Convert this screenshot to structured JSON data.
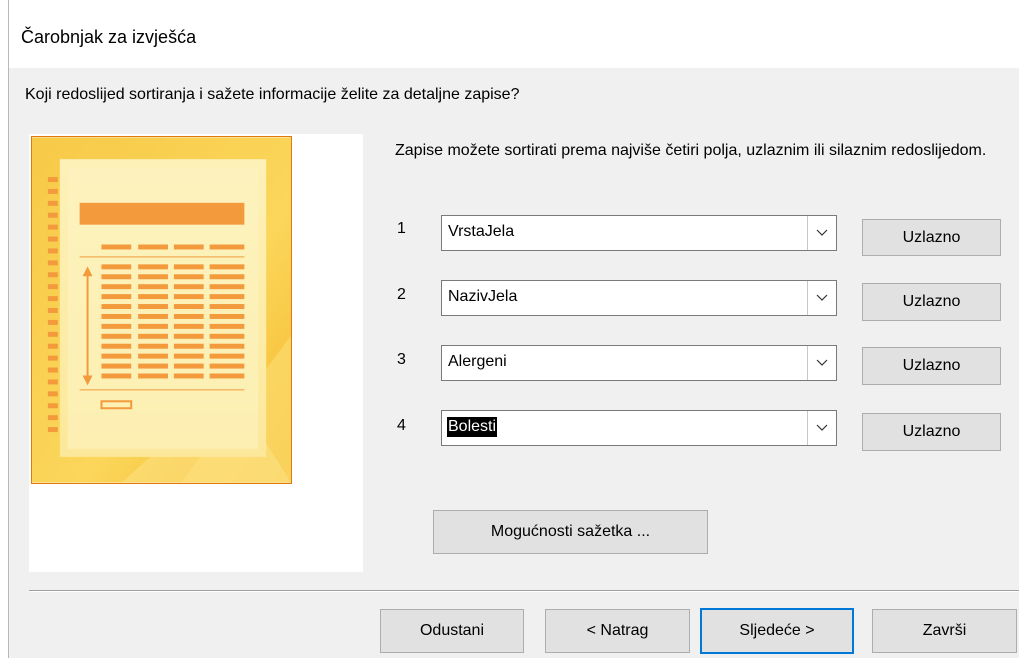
{
  "dialog": {
    "title": "Čarobnjak za izvješća",
    "question": "Koji redoslijed sortiranja i sažete informacije želite za detaljne zapise?",
    "intro": "Zapise možete sortirati prema najviše četiri polja, uzlaznim ili silaznim redoslijedom."
  },
  "sort_rows": [
    {
      "number": "1",
      "field": "VrstaJela",
      "order": "Uzlazno"
    },
    {
      "number": "2",
      "field": "NazivJela",
      "order": "Uzlazno"
    },
    {
      "number": "3",
      "field": "Alergeni",
      "order": "Uzlazno"
    },
    {
      "number": "4",
      "field": "Bolesti",
      "order": "Uzlazno"
    }
  ],
  "summary_button": "Mogućnosti sažetka ...",
  "footer": {
    "cancel": "Odustani",
    "back": "< Natrag",
    "next": "Sljedeće >",
    "finish": "Završi"
  },
  "colors": {
    "focus": "#0078d7",
    "illustration_orange": "#f29a3c",
    "illustration_yellow": "#fde68a"
  }
}
